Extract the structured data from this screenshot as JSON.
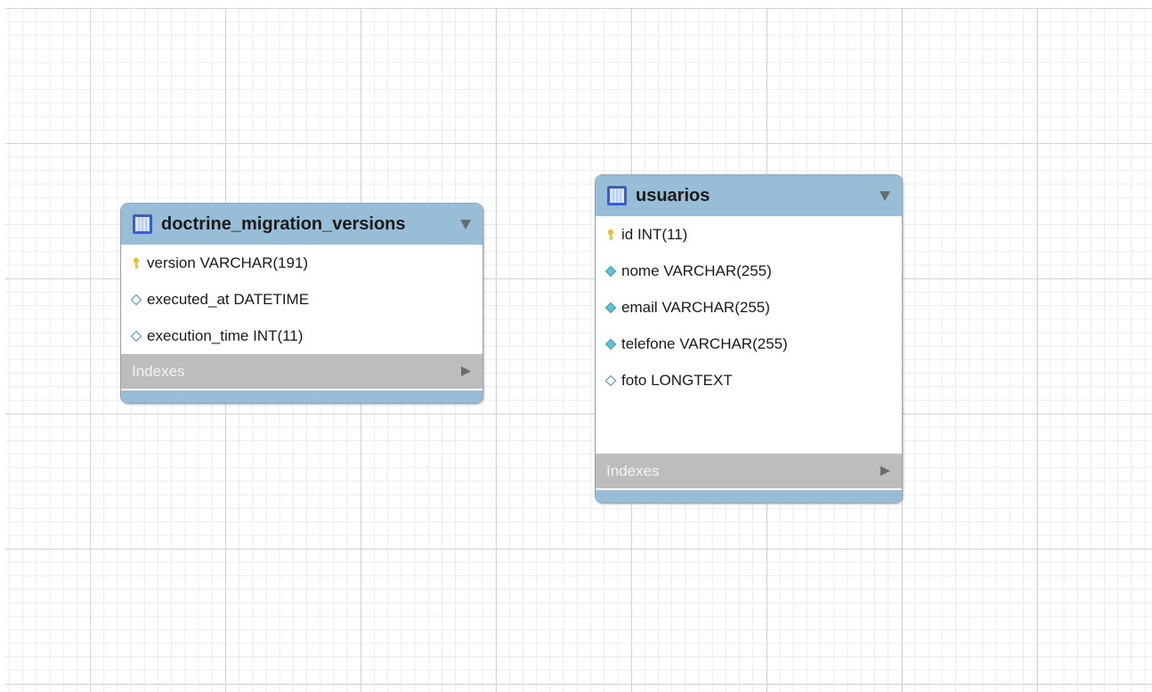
{
  "tables": [
    {
      "name": "doctrine_migration_versions",
      "columns": [
        {
          "text": "version VARCHAR(191)",
          "icon": "primary-key-icon"
        },
        {
          "text": "executed_at DATETIME",
          "icon": "nullable-column-icon"
        },
        {
          "text": "execution_time INT(11)",
          "icon": "nullable-column-icon"
        }
      ],
      "indexes_label": "Indexes"
    },
    {
      "name": "usuarios",
      "columns": [
        {
          "text": "id INT(11)",
          "icon": "primary-key-icon"
        },
        {
          "text": "nome VARCHAR(255)",
          "icon": "not-null-column-icon"
        },
        {
          "text": "email VARCHAR(255)",
          "icon": "not-null-column-icon"
        },
        {
          "text": "telefone VARCHAR(255)",
          "icon": "not-null-column-icon"
        },
        {
          "text": "foto LONGTEXT",
          "icon": "nullable-column-icon"
        }
      ],
      "indexes_label": "Indexes"
    }
  ],
  "colors": {
    "header": "#98bdd6",
    "indexes_bar": "#bdbdbd",
    "key_icon": "#e6c13c",
    "not_null_icon": "#5cc6d6",
    "grid_major": "#d4d4d4",
    "grid_minor": "#ececec"
  }
}
